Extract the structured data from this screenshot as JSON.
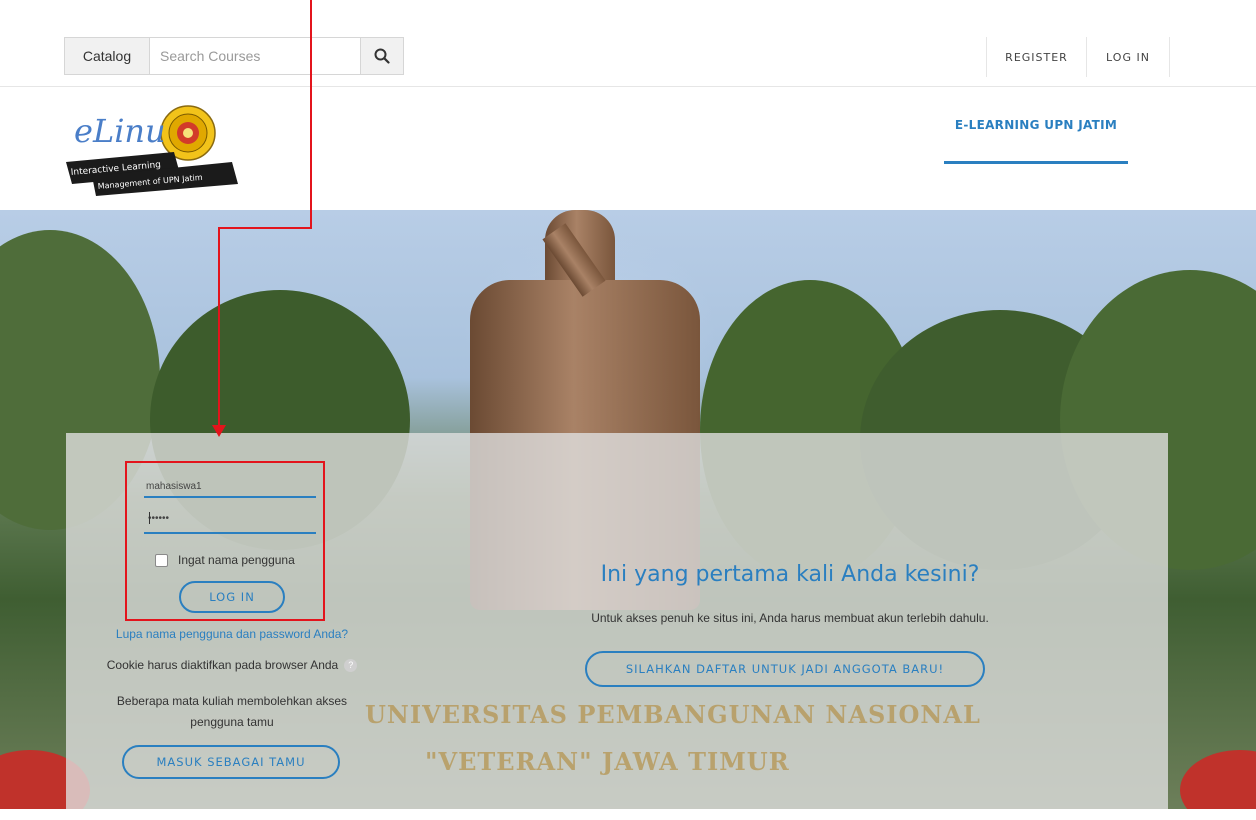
{
  "topbar": {
    "catalog_label": "Catalog",
    "search_placeholder": "Search Courses",
    "search_icon": "search-icon",
    "register_label": "REGISTER",
    "login_label": "LOG IN"
  },
  "header": {
    "logo_text_main": "eLinu",
    "logo_text_sub1": "Interactive Learning",
    "logo_text_sub2": "Management of UPN Jatim",
    "nav_label": "E-LEARNING UPN JATIM"
  },
  "login": {
    "username_value": "mahasiswa1",
    "password_value": "••••••",
    "remember_label": "Ingat nama pengguna",
    "login_button": "LOG IN",
    "forgot_link": "Lupa nama pengguna dan password Anda?",
    "cookie_note": "Cookie harus diaktifkan pada browser Anda",
    "guest_note": "Beberapa mata kuliah membolehkan akses pengguna tamu",
    "guest_button": "MASUK SEBAGAI TAMU"
  },
  "signup": {
    "title": "Ini yang pertama kali Anda kesini?",
    "text": "Untuk akses penuh ke situs ini, Anda harus membuat akun terlebih dahulu.",
    "button": "SILAHKAN DAFTAR UNTUK JADI ANGGOTA BARU!"
  },
  "background": {
    "banner_line1": "UNIVERSITAS PEMBANGUNAN NASIONAL",
    "banner_line2": "\"VETERAN\" JAWA TIMUR"
  },
  "colors": {
    "accent": "#2a7fc0",
    "annotation": "#e3141c"
  }
}
